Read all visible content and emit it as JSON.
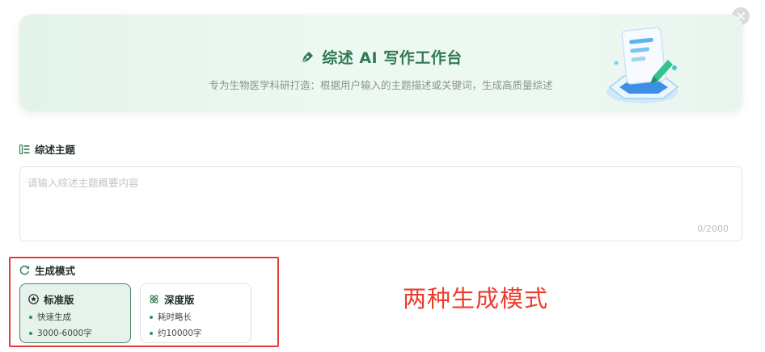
{
  "header": {
    "title": "综述 AI 写作工作台",
    "subtitle": "专为生物医学科研打造：根据用户输入的主题描述或关键词，生成高质量综述"
  },
  "topic": {
    "label": "综述主题",
    "placeholder": "请输入综述主题概要内容",
    "value": "",
    "counter": "0/2000"
  },
  "mode": {
    "label": "生成模式",
    "options": [
      {
        "name": "标准版",
        "features": [
          "快速生成",
          "3000-6000字"
        ],
        "selected": true
      },
      {
        "name": "深度版",
        "features": [
          "耗时略长",
          "约10000字"
        ],
        "selected": false
      }
    ]
  },
  "annotation": "两种生成模式",
  "colors": {
    "accent": "#3f8a63",
    "annotation": "#ee3b2f",
    "highlight_border": "#e53935"
  }
}
